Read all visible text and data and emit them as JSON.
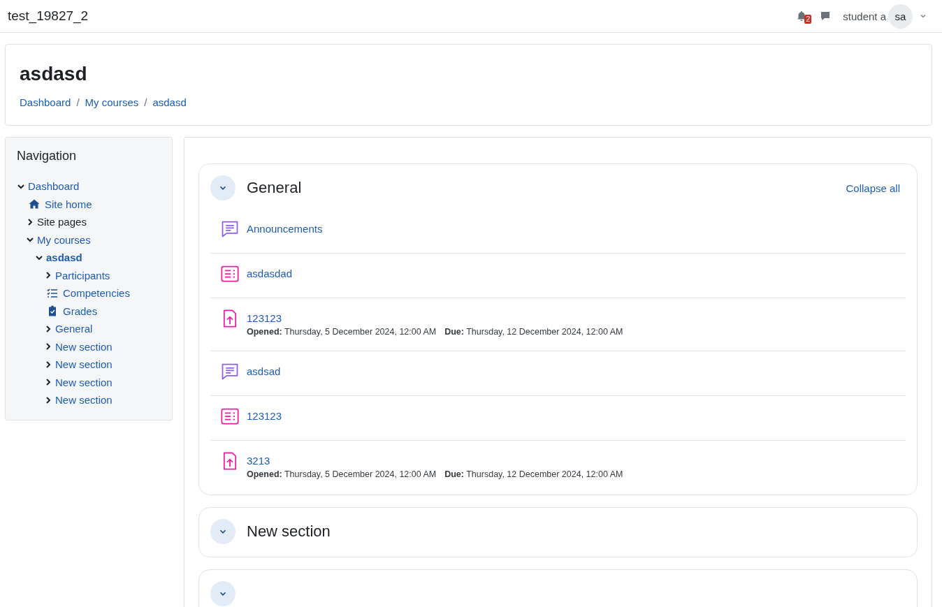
{
  "navbar": {
    "site_name": "test_19827_2",
    "notification_count": "2",
    "user_name": "student a",
    "avatar_initials": "sa"
  },
  "header": {
    "title": "asdasd",
    "breadcrumb": [
      "Dashboard",
      "/",
      "My courses",
      "/",
      "asdasd"
    ]
  },
  "navigation": {
    "title": "Navigation",
    "items": [
      {
        "label": "Dashboard",
        "kind": "expander",
        "expanded": true,
        "link": true,
        "current": false,
        "children": [
          {
            "label": "Site home",
            "kind": "home",
            "link": true,
            "current": false
          },
          {
            "label": "Site pages",
            "kind": "expander",
            "expanded": false,
            "link": false,
            "current": false
          },
          {
            "label": "My courses",
            "kind": "expander",
            "expanded": true,
            "link": true,
            "current": false,
            "children": [
              {
                "label": "asdasd",
                "kind": "expander",
                "expanded": true,
                "link": true,
                "current": true,
                "children": [
                  {
                    "label": "Participants",
                    "kind": "expander",
                    "expanded": false,
                    "link": true,
                    "current": false
                  },
                  {
                    "label": "Competencies",
                    "kind": "checklist",
                    "link": true,
                    "current": false
                  },
                  {
                    "label": "Grades",
                    "kind": "clipboard",
                    "link": true,
                    "current": false
                  },
                  {
                    "label": "General",
                    "kind": "expander",
                    "expanded": false,
                    "link": true,
                    "current": false
                  },
                  {
                    "label": "New section",
                    "kind": "expander",
                    "expanded": false,
                    "link": true,
                    "current": false
                  },
                  {
                    "label": "New section",
                    "kind": "expander",
                    "expanded": false,
                    "link": true,
                    "current": false
                  },
                  {
                    "label": "New section",
                    "kind": "expander",
                    "expanded": false,
                    "link": true,
                    "current": false
                  },
                  {
                    "label": "New section",
                    "kind": "expander",
                    "expanded": false,
                    "link": true,
                    "current": false
                  }
                ]
              }
            ]
          }
        ]
      }
    ]
  },
  "collapse_all": "Collapse all",
  "sections": [
    {
      "title": "General",
      "expanded": true,
      "activities": [
        {
          "kind": "forum",
          "name": "Announcements"
        },
        {
          "kind": "quiz",
          "name": "asdasdad"
        },
        {
          "kind": "assign",
          "name": "123123",
          "opened_label": "Opened:",
          "opened": "Thursday, 5 December 2024, 12:00 AM",
          "due_label": "Due:",
          "due": "Thursday, 12 December 2024, 12:00 AM"
        },
        {
          "kind": "forum",
          "name": "asdsad"
        },
        {
          "kind": "quiz",
          "name": "123123"
        },
        {
          "kind": "assign",
          "name": "3213",
          "opened_label": "Opened:",
          "opened": "Thursday, 5 December 2024, 12:00 AM",
          "due_label": "Due:",
          "due": "Thursday, 12 December 2024, 12:00 AM"
        }
      ]
    },
    {
      "title": "New section",
      "expanded": true
    },
    {
      "expanded": true
    }
  ]
}
